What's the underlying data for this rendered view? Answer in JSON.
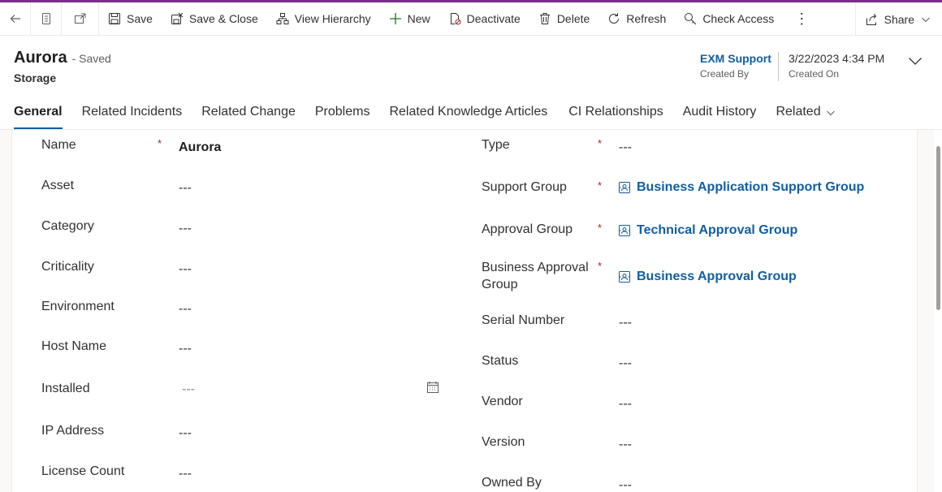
{
  "toolbar": {
    "save": "Save",
    "save_close": "Save & Close",
    "view_hierarchy": "View Hierarchy",
    "new": "New",
    "deactivate": "Deactivate",
    "delete": "Delete",
    "refresh": "Refresh",
    "check_access": "Check Access",
    "more": "⋮",
    "share": "Share"
  },
  "header": {
    "title": "Aurora",
    "status": "- Saved",
    "entity": "Storage",
    "created_by_value": "EXM Support",
    "created_by_label": "Created By",
    "created_on_value": "3/22/2023 4:34 PM",
    "created_on_label": "Created On"
  },
  "tabs": [
    {
      "label": "General"
    },
    {
      "label": "Related Incidents"
    },
    {
      "label": "Related Change"
    },
    {
      "label": "Problems"
    },
    {
      "label": "Related Knowledge Articles"
    },
    {
      "label": "CI Relationships"
    },
    {
      "label": "Audit History"
    },
    {
      "label": "Related"
    }
  ],
  "form": {
    "required_mark": "*",
    "left": [
      {
        "label": "Name",
        "value": "Aurora"
      },
      {
        "label": "Asset",
        "value": "---"
      },
      {
        "label": "Category",
        "value": "---"
      },
      {
        "label": "Criticality",
        "value": "---"
      },
      {
        "label": "Environment",
        "value": "---"
      },
      {
        "label": "Host Name",
        "value": "---"
      },
      {
        "label": "Installed",
        "value": "---"
      },
      {
        "label": "IP Address",
        "value": "---"
      },
      {
        "label": "License Count",
        "value": "---"
      }
    ],
    "right": [
      {
        "label": "Type",
        "value": "---"
      },
      {
        "label": "Support Group",
        "value": "Business Application Support Group"
      },
      {
        "label": "Approval Group",
        "value": "Technical Approval Group"
      },
      {
        "label_line1": "Business Approval",
        "label_line2": "Group",
        "value": "Business Approval Group"
      },
      {
        "label": "Serial Number",
        "value": "---"
      },
      {
        "label": "Status",
        "value": "---"
      },
      {
        "label": "Vendor",
        "value": "---"
      },
      {
        "label": "Version",
        "value": "---"
      },
      {
        "label": "Owned By",
        "value": "---"
      }
    ]
  },
  "colors": {
    "accent_top": "#7b2d8b",
    "link": "#115ea3",
    "required": "#a4262c"
  }
}
